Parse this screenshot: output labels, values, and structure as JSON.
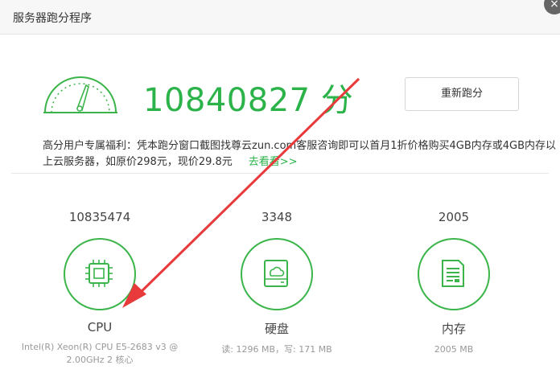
{
  "window": {
    "title": "服务器跑分程序"
  },
  "summary": {
    "score": "10840827 分",
    "rerun_label": "重新跑分"
  },
  "promo": {
    "text": "高分用户专属福利：凭本跑分窗口截图找尊云zun.com客服咨询即可以首月1折价格购买4GB内存或4GB内存以上云服务器，如原价298元，现价29.8元",
    "link_label": "去看看>>"
  },
  "metrics": [
    {
      "score": "10835474",
      "label": "CPU",
      "detail": "Intel(R) Xeon(R) CPU E5-2683 v3 @ 2.00GHz 2 核心",
      "icon": "cpu-icon"
    },
    {
      "score": "3348",
      "label": "硬盘",
      "detail": "读: 1296 MB，写: 171 MB",
      "icon": "disk-icon"
    },
    {
      "score": "2005",
      "label": "内存",
      "detail": "2005 MB",
      "icon": "memory-icon"
    }
  ],
  "colors": {
    "accent": "#2bb34a",
    "arrow": "#e8393b"
  }
}
